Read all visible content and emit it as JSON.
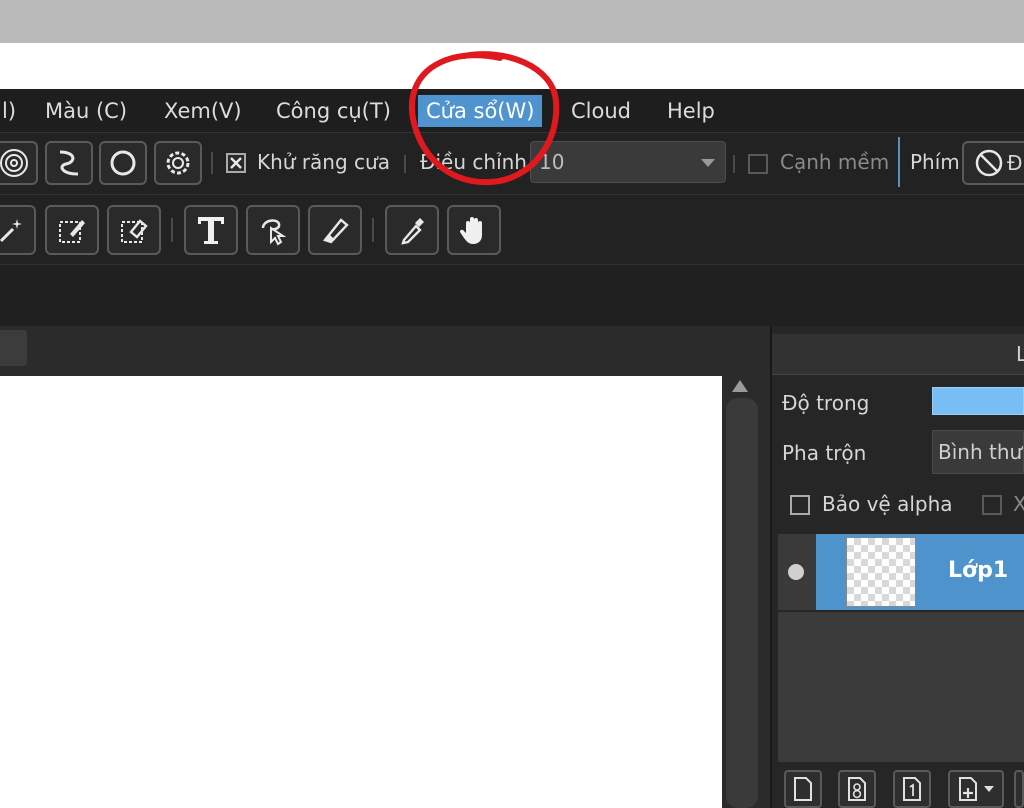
{
  "menu": {
    "items": [
      {
        "label": "l)",
        "active": false
      },
      {
        "label": "Màu (C)",
        "active": false
      },
      {
        "label": "Xem(V)",
        "active": false
      },
      {
        "label": "Công cụ(T)",
        "active": false
      },
      {
        "label": "Cửa sổ(W)",
        "active": true
      },
      {
        "label": "Cloud",
        "active": false
      },
      {
        "label": "Help",
        "active": false
      }
    ]
  },
  "toolbar1": {
    "antialias_label": "Khử răng cưa",
    "antialias_checked": true,
    "adjust_label": "Điều chỉnh",
    "adjust_value": "10",
    "soft_edge_label": "Cạnh mềm",
    "soft_edge_checked": false,
    "key_label": "Phím",
    "trailing_button_label": "Đ"
  },
  "toolbar2": {
    "tools": [
      "magic-wand",
      "select-pen",
      "select-eraser",
      "text",
      "lasso-select",
      "eraser-knife",
      "eyedropper",
      "hand"
    ]
  },
  "layers_panel": {
    "header_title": "L",
    "opacity_label": "Độ trong",
    "blend_label": "Pha trộn",
    "blend_value": "Bình thường",
    "protect_alpha_label": "Bảo vệ alpha",
    "protect_alpha_checked": false,
    "clip_label": "X",
    "layers": [
      {
        "name": "Lớp1",
        "visible": true,
        "selected": true
      }
    ]
  },
  "colors": {
    "accent": "#4f93cf",
    "annotation": "#e0191e"
  }
}
